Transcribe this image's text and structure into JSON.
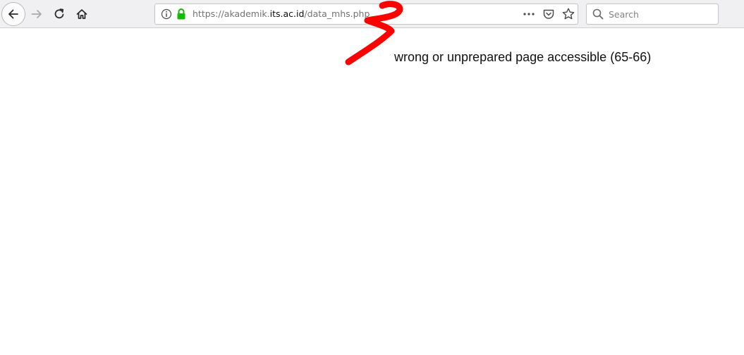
{
  "browser": {
    "url": {
      "prefix": "https://akademik.",
      "domain": "its.ac.id",
      "path": "/data_mhs.php"
    },
    "search": {
      "placeholder": "Search"
    },
    "icons": {
      "back": "back-arrow-icon",
      "forward": "forward-arrow-icon",
      "reload": "reload-icon",
      "home": "home-icon",
      "info": "info-icon",
      "lock": "lock-icon",
      "more": "more-dots-icon",
      "pocket": "pocket-icon",
      "bookmark": "star-icon",
      "search": "search-icon"
    },
    "colors": {
      "secure_lock": "#12bc00",
      "annotation": "#ff0000"
    }
  },
  "annotation": {
    "text": "wrong or unprepared page accessible (65-66)"
  }
}
